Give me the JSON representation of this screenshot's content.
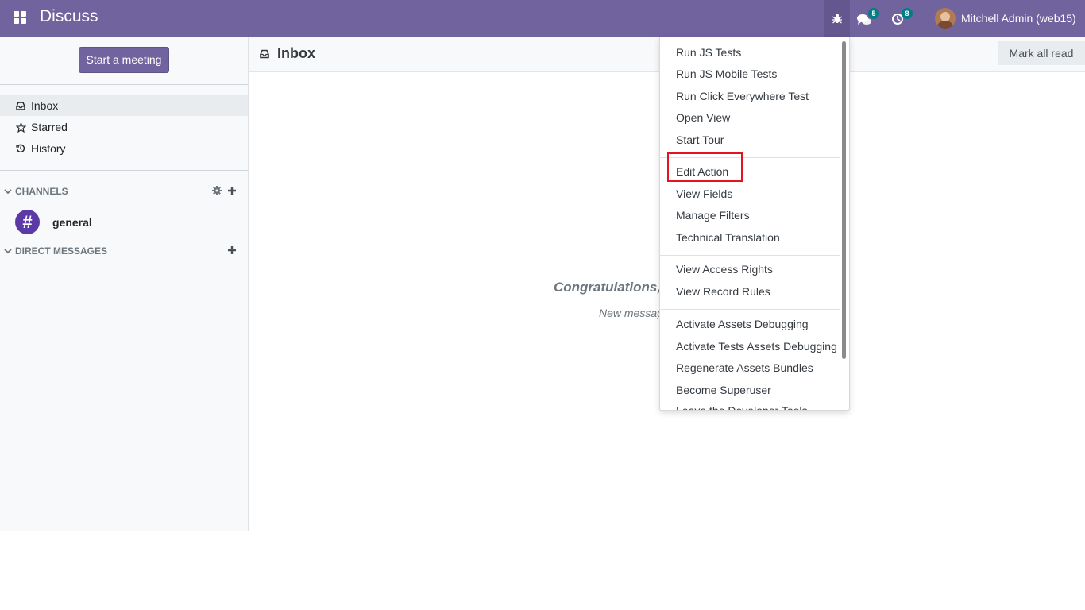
{
  "navbar": {
    "brand": "Discuss",
    "apps_icon": "grid-apps-icon",
    "debug_icon": "bug-icon",
    "chat_icon": "chat-bubbles-icon",
    "chat_badge": "5",
    "activity_icon": "clock-activity-icon",
    "activity_badge": "8",
    "user_name": "Mitchell Admin (web15)",
    "colors": {
      "bar": "#71639e",
      "badge": "#017e84"
    }
  },
  "sidebar": {
    "start_meeting": "Start a meeting",
    "mailboxes": [
      {
        "label": "Inbox",
        "icon": "inbox-icon",
        "active": true
      },
      {
        "label": "Starred",
        "icon": "star-icon",
        "active": false
      },
      {
        "label": "History",
        "icon": "history-icon",
        "active": false
      }
    ],
    "channels_header": "CHANNELS",
    "channels": [
      {
        "name": "general",
        "icon": "hash-icon"
      }
    ],
    "direct_header": "DIRECT MESSAGES"
  },
  "main": {
    "title": "Inbox",
    "mark_all_read": "Mark all read",
    "empty_title": "Congratulations,",
    "empty_subtitle": "New messag"
  },
  "debug_menu": {
    "groups": [
      [
        "Run JS Tests",
        "Run JS Mobile Tests",
        "Run Click Everywhere Test",
        "Open View",
        "Start Tour"
      ],
      [
        "Edit Action",
        "View Fields",
        "Manage Filters",
        "Technical Translation"
      ],
      [
        "View Access Rights",
        "View Record Rules"
      ],
      [
        "Activate Assets Debugging",
        "Activate Tests Assets Debugging",
        "Regenerate Assets Bundles",
        "Become Superuser",
        "Leave the Developer Tools"
      ]
    ],
    "highlighted_item": "Edit Action",
    "highlight_color": "#e3141c"
  }
}
